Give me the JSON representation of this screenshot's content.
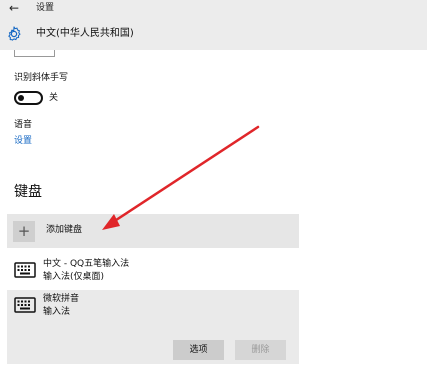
{
  "titlebar": {
    "back_icon": "arrow-left-icon",
    "title": "设置"
  },
  "header": {
    "icon": "gear-icon",
    "title": "中文(中华人民共和国)"
  },
  "handwriting": {
    "label": "识别斜体手写",
    "toggle_state": "关",
    "toggle_on": false
  },
  "voice": {
    "label": "语音",
    "link": "设置"
  },
  "keyboards": {
    "heading": "键盘",
    "add_label": "添加键盘",
    "add_icon": "plus-icon",
    "items": [
      {
        "name": "中文 - QQ五笔输入法",
        "desc": "输入法(仅桌面)",
        "icon": "keyboard-icon"
      },
      {
        "name": "微软拼音",
        "desc": "输入法",
        "icon": "keyboard-icon"
      }
    ],
    "options_button": "选项",
    "remove_button": "删除"
  },
  "colors": {
    "link": "#1769c4",
    "arrow": "#e0262a",
    "header_bg": "#ececec"
  }
}
